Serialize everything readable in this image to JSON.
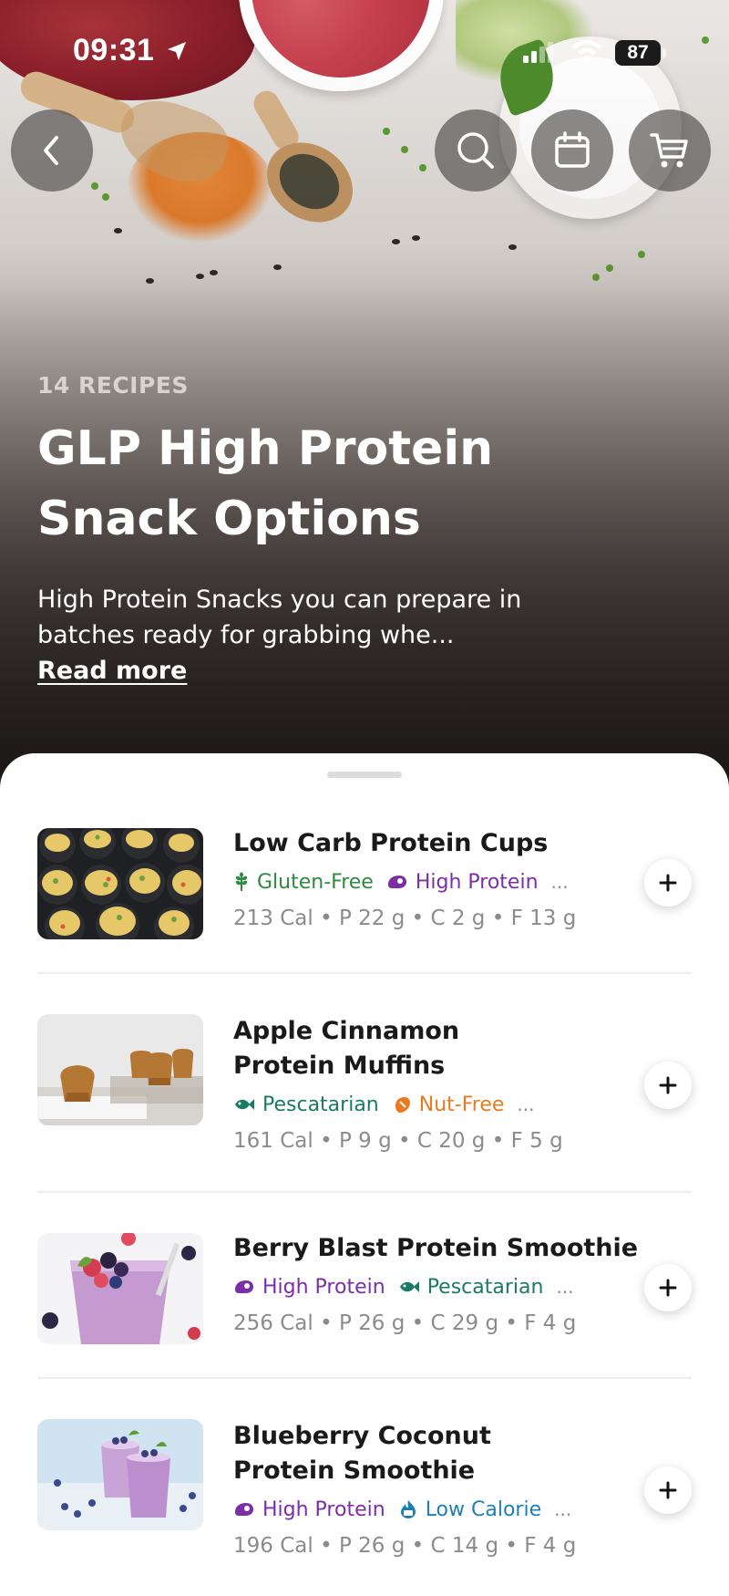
{
  "status_bar": {
    "time": "09:31",
    "battery": "87"
  },
  "header": {
    "count_label": "14 RECIPES",
    "title": "GLP High Protein Snack Options",
    "description": "High Protein Snacks you can prepare in batches ready for grabbing whe...",
    "read_more": "Read more"
  },
  "colors": {
    "gluten_free": "#2e8a3e",
    "high_protein": "#7b2fa5",
    "pescatarian": "#1a7a66",
    "nut_free": "#ea7a1d",
    "low_calorie": "#1f7fb4"
  },
  "recipes": [
    {
      "title": "Low Carb Protein Cups",
      "tags": [
        {
          "label": "Gluten-Free",
          "icon": "wheat-icon",
          "color": "#2e8a3e"
        },
        {
          "label": "High Protein",
          "icon": "protein-icon",
          "color": "#7b2fa5"
        }
      ],
      "more": "...",
      "macros": "213 Cal • P 22 g • C 2 g • F 13 g"
    },
    {
      "title": "Apple Cinnamon Protein Muffins",
      "tags": [
        {
          "label": "Pescatarian",
          "icon": "fish-icon",
          "color": "#1a7a66"
        },
        {
          "label": "Nut-Free",
          "icon": "nut-icon",
          "color": "#ea7a1d"
        }
      ],
      "more": "...",
      "macros": "161 Cal • P 9 g • C 20 g • F 5 g"
    },
    {
      "title": "Berry Blast Protein Smoothie",
      "tags": [
        {
          "label": "High Protein",
          "icon": "protein-icon",
          "color": "#7b2fa5"
        },
        {
          "label": "Pescatarian",
          "icon": "fish-icon",
          "color": "#1a7a66"
        }
      ],
      "more": "...",
      "macros": "256 Cal • P 26 g • C 29 g • F 4 g"
    },
    {
      "title": "Blueberry Coconut Protein Smoothie",
      "tags": [
        {
          "label": "High Protein",
          "icon": "protein-icon",
          "color": "#7b2fa5"
        },
        {
          "label": "Low Calorie",
          "icon": "flame-kcal-icon",
          "color": "#1f7fb4"
        }
      ],
      "more": "...",
      "macros": "196 Cal • P 26 g • C 14 g • F 4 g"
    }
  ]
}
